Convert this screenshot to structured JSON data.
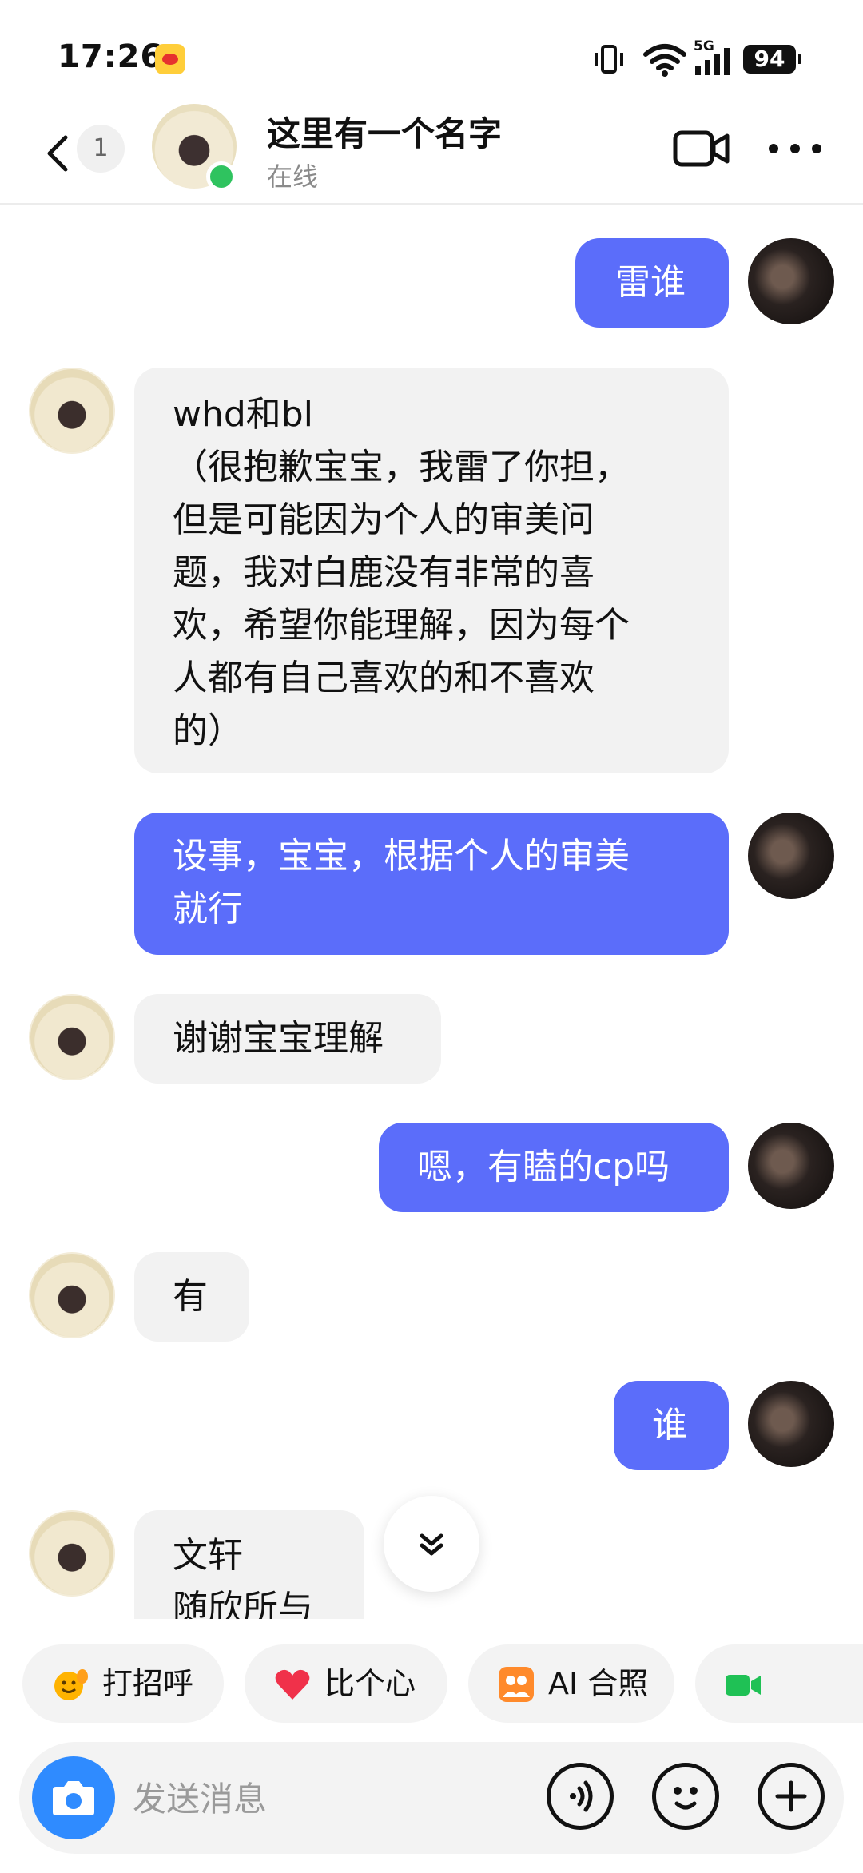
{
  "status_bar": {
    "time": "17:26",
    "network": "5G",
    "battery": "94"
  },
  "header": {
    "title": "这里有一个名字",
    "status": "在线",
    "unread_count": "1"
  },
  "messages": [
    {
      "sender": "me",
      "text": "雷谁"
    },
    {
      "sender": "other",
      "text": "whd和bl\n（很抱歉宝宝，我雷了你担，\n但是可能因为个人的审美问\n题，我对白鹿没有非常的喜\n欢，希望你能理解，因为每个\n人都有自己喜欢的和不喜欢\n的）"
    },
    {
      "sender": "me",
      "text": "设事，宝宝，根据个人的审美\n就行"
    },
    {
      "sender": "other",
      "text": "谢谢宝宝理解"
    },
    {
      "sender": "me",
      "text": "嗯，有瞌的cp吗"
    },
    {
      "sender": "other",
      "text": "有"
    },
    {
      "sender": "me",
      "text": "谁"
    },
    {
      "sender": "other",
      "text": "文轩\n随欣所与"
    }
  ],
  "quick_actions": [
    {
      "label": "打招呼",
      "icon": "wave-emoji-icon"
    },
    {
      "label": "比个心",
      "icon": "heart-icon"
    },
    {
      "label": "AI 合照",
      "icon": "ai-photo-icon"
    },
    {
      "label": "",
      "icon": "video-call-icon"
    }
  ],
  "input": {
    "placeholder": "发送消息"
  },
  "colors": {
    "my_bubble": "#5b6dfa",
    "other_bubble": "#f2f2f2",
    "online": "#2fc35f",
    "camera": "#2f8bff"
  }
}
